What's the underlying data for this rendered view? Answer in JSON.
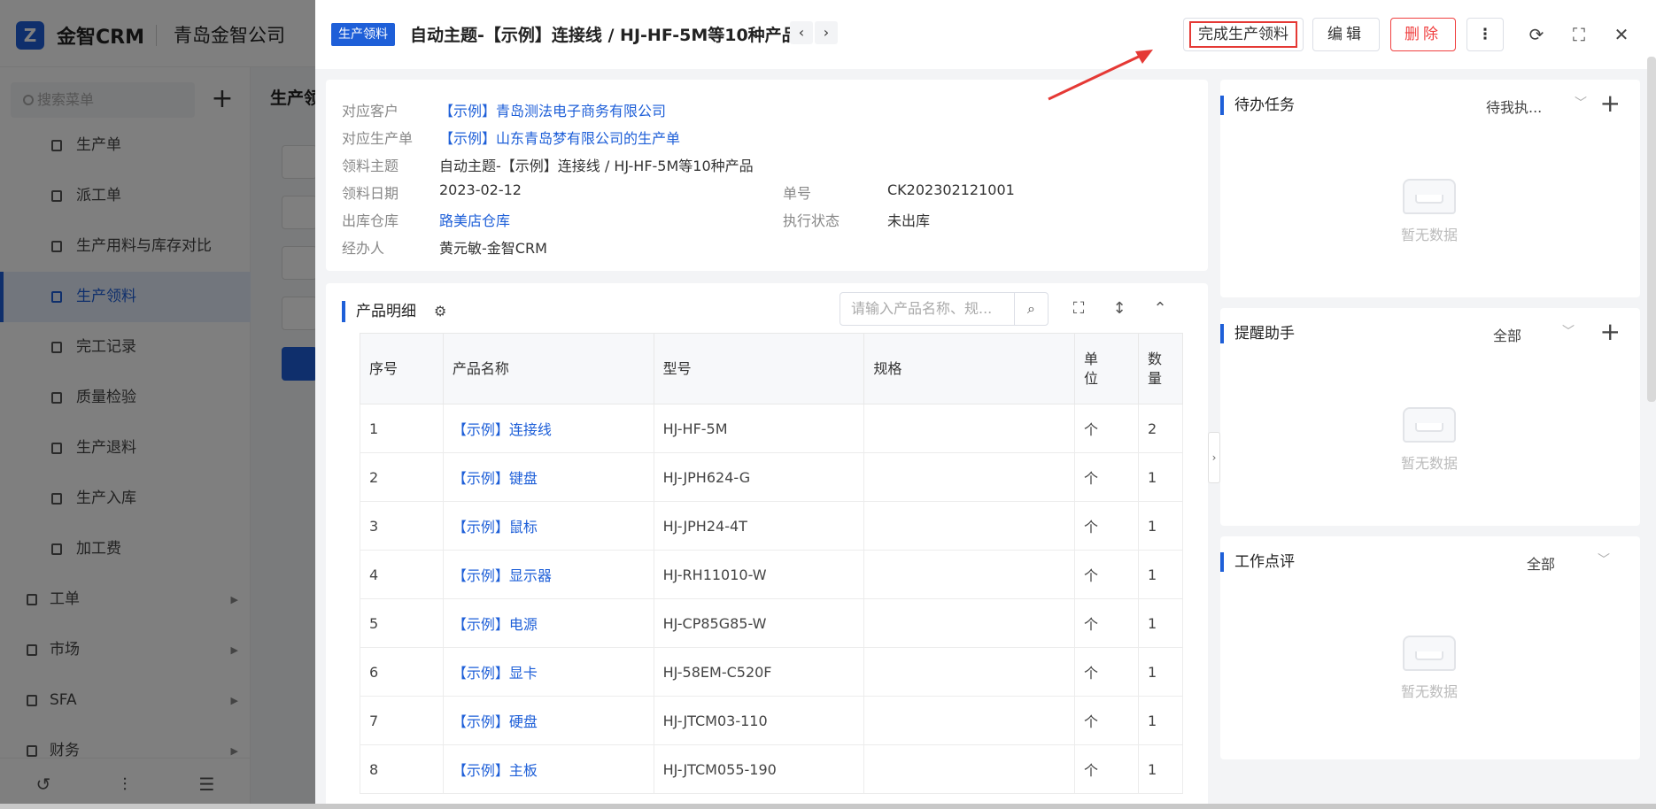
{
  "app": {
    "brand": "金智CRM",
    "logo_letter": "Z",
    "company": "青岛金智公司",
    "page_title": "生产领"
  },
  "sidebar": {
    "search_placeholder": "搜索菜单",
    "add": "+",
    "items": [
      {
        "label": "生产单",
        "icon": "production-icon"
      },
      {
        "label": "派工单",
        "icon": "person-icon"
      },
      {
        "label": "生产用料与库存对比",
        "icon": "chart-icon"
      },
      {
        "label": "生产领料",
        "icon": "doc-icon",
        "active": true
      },
      {
        "label": "完工记录",
        "icon": "edit-icon"
      },
      {
        "label": "质量检验",
        "icon": "shield-icon"
      },
      {
        "label": "生产退料",
        "icon": "doc-icon"
      },
      {
        "label": "生产入库",
        "icon": "doc-icon"
      },
      {
        "label": "加工费",
        "icon": "box-icon"
      }
    ],
    "groups": [
      {
        "label": "工单"
      },
      {
        "label": "市场"
      },
      {
        "label": "SFA"
      },
      {
        "label": "财务"
      }
    ],
    "bottom_icons": [
      "history-icon",
      "filter-settings-icon",
      "collapse-menu-icon"
    ]
  },
  "drawer": {
    "tag": "生产领料",
    "title": "自动主题-【示例】连接线 / HJ-HF-5M等10种产品",
    "prev": "‹",
    "next": "›",
    "buttons": {
      "done": "完成生产领料",
      "edit": "编辑",
      "delete": "删除",
      "more": "⋮"
    },
    "icons": [
      "refresh-icon",
      "fullscreen-icon",
      "close-icon"
    ],
    "info": {
      "customer_label": "对应客户",
      "customer": "【示例】青岛测法电子商务有限公司",
      "order_label": "对应生产单",
      "order": "【示例】山东青岛梦有限公司的生产单",
      "subject_label": "领料主题",
      "subject": "自动主题-【示例】连接线 / HJ-HF-5M等10种产品",
      "date_label": "领料日期",
      "date": "2023-02-12",
      "number_label": "单号",
      "number": "CK202302121001",
      "warehouse_label": "出库仓库",
      "warehouse": "路美店仓库",
      "status_label": "执行状态",
      "status": "未出库",
      "handler_label": "经办人",
      "handler": "黄元敏-金智CRM"
    },
    "products": {
      "title": "产品明细",
      "search_placeholder": "请输入产品名称、规...",
      "columns": [
        "序号",
        "产品名称",
        "型号",
        "规格",
        "单位",
        "数量"
      ],
      "rows": [
        [
          "1",
          "【示例】连接线",
          "HJ-HF-5M",
          "",
          "个",
          "2"
        ],
        [
          "2",
          "【示例】键盘",
          "HJ-JPH624-G",
          "",
          "个",
          "1"
        ],
        [
          "3",
          "【示例】鼠标",
          "HJ-JPH24-4T",
          "",
          "个",
          "1"
        ],
        [
          "4",
          "【示例】显示器",
          "HJ-RH11010-W",
          "",
          "个",
          "1"
        ],
        [
          "5",
          "【示例】电源",
          "HJ-CP85G85-W",
          "",
          "个",
          "1"
        ],
        [
          "6",
          "【示例】显卡",
          "HJ-58EM-C520F",
          "",
          "个",
          "1"
        ],
        [
          "7",
          "【示例】硬盘",
          "HJ-JTCM03-110",
          "",
          "个",
          "1"
        ],
        [
          "8",
          "【示例】主板",
          "HJ-JTCM055-190",
          "",
          "个",
          "1"
        ]
      ]
    },
    "panels": [
      {
        "title": "待办任务",
        "filter": "待我执...",
        "plus": "+",
        "empty": "暂无数据"
      },
      {
        "title": "提醒助手",
        "filter": "全部",
        "plus": "+",
        "empty": "暂无数据"
      },
      {
        "title": "工作点评",
        "filter": "全部",
        "empty": "暂无数据"
      }
    ]
  },
  "colors": {
    "accent": "#1e5fd8",
    "danger": "#f04040",
    "annotation": "#e53935"
  }
}
